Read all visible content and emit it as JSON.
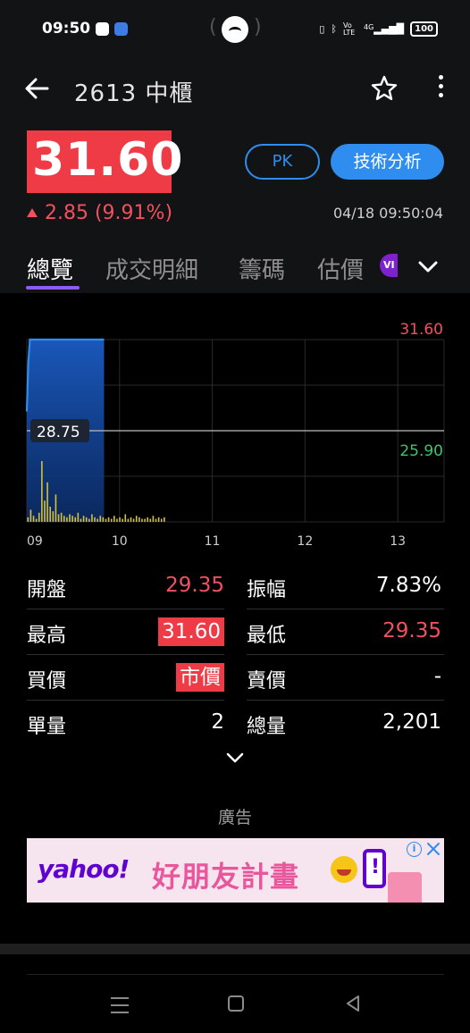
{
  "status_bar": {
    "time": "09:50",
    "battery": "100",
    "network": "4G",
    "volte": "Vo LTE"
  },
  "header": {
    "title": "2613 中櫃"
  },
  "quote": {
    "price": "31.60",
    "change": "2.85 (9.91%)",
    "timestamp": "04/18 09:50:04",
    "pk_label": "PK",
    "ta_label": "技術分析",
    "price_color": "#ef3b45",
    "up_color": "#f25060"
  },
  "tabs": [
    {
      "label": "總覽",
      "active": true
    },
    {
      "label": "成交明細",
      "active": false
    },
    {
      "label": "籌碼",
      "active": false
    },
    {
      "label": "估價",
      "active": false
    }
  ],
  "vip_badge": "VI",
  "chart_data": {
    "type": "line",
    "title": "",
    "x_ticks": [
      "09",
      "10",
      "11",
      "12",
      "13"
    ],
    "y_high_label": "31.60",
    "y_ref_label": "28.75",
    "y_low_label": "25.90",
    "ylim": [
      25.9,
      31.6
    ],
    "reference": 28.75,
    "price_series": {
      "x": [
        "09:00",
        "09:01",
        "09:02",
        "09:05",
        "09:10",
        "09:20",
        "09:30",
        "09:40",
        "09:50"
      ],
      "values": [
        29.35,
        30.9,
        31.6,
        31.6,
        31.6,
        31.6,
        31.6,
        31.6,
        31.6
      ]
    },
    "volume_series": {
      "values": [
        3,
        8,
        4,
        2,
        6,
        40,
        14,
        26,
        10,
        7,
        18,
        5,
        6,
        4,
        3,
        5,
        4,
        3,
        6,
        2,
        4,
        3,
        2,
        5,
        3,
        2,
        4,
        3,
        2,
        3,
        2,
        4,
        2,
        3,
        2,
        5,
        2,
        3,
        2,
        4,
        3,
        2,
        2,
        3,
        2,
        4,
        2,
        3,
        2,
        3
      ]
    },
    "colors": {
      "high": "#f25060",
      "low": "#3ec46d",
      "line": "#2f8df0",
      "volume": "#d4c03a"
    }
  },
  "stats": [
    {
      "label_l": "開盤",
      "value_l": "29.35",
      "style_l": "red",
      "label_r": "振幅",
      "value_r": "7.83%",
      "style_r": "white"
    },
    {
      "label_l": "最高",
      "value_l": "31.60",
      "style_l": "boxed",
      "label_r": "最低",
      "value_r": "29.35",
      "style_r": "red"
    },
    {
      "label_l": "買價",
      "value_l": "市價",
      "style_l": "boxed",
      "label_r": "賣價",
      "value_r": "-",
      "style_r": "white"
    },
    {
      "label_l": "單量",
      "value_l": "2",
      "style_l": "white",
      "label_r": "總量",
      "value_r": "2,201",
      "style_r": "white"
    }
  ],
  "ad": {
    "label": "廣告",
    "brand": "yahoo!",
    "headline": "好朋友計畫"
  }
}
